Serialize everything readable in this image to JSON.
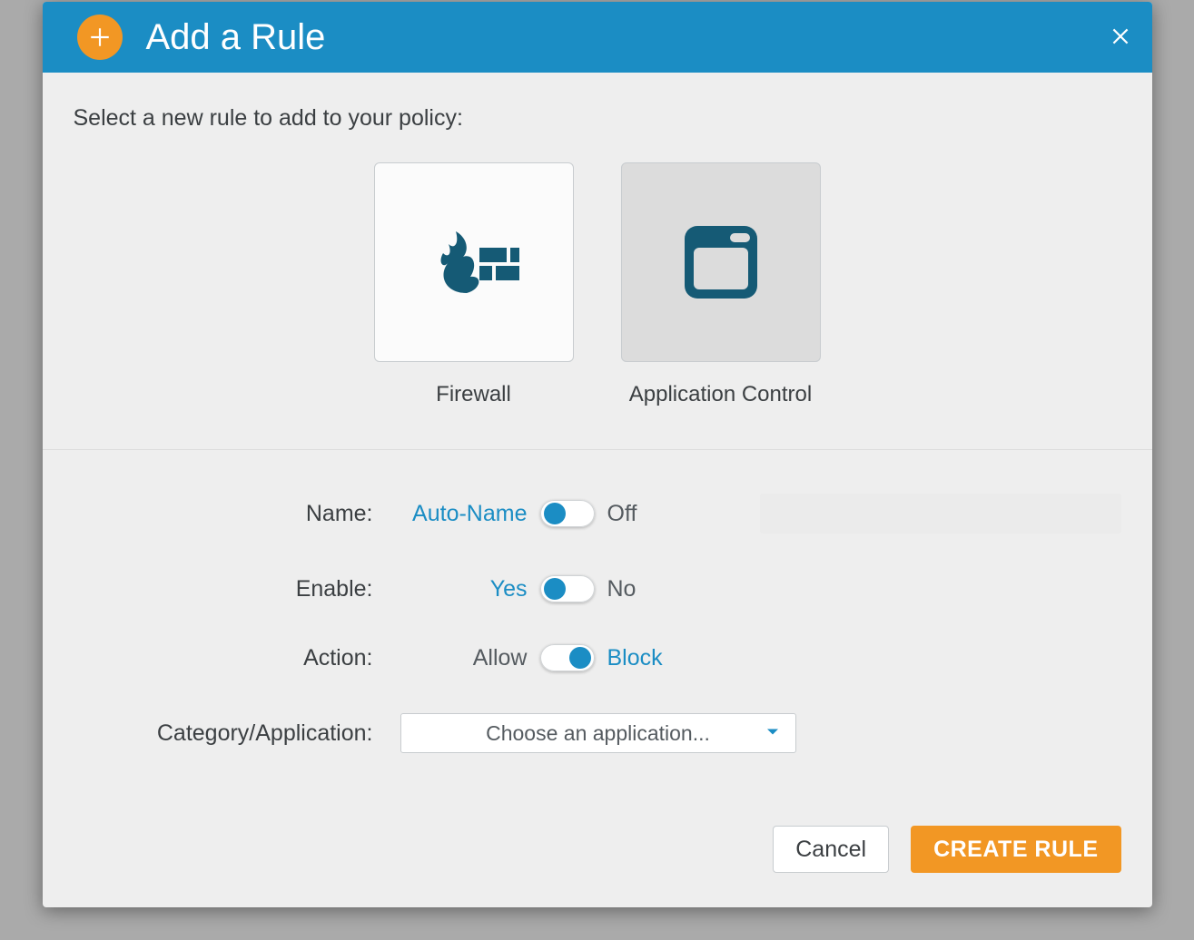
{
  "header": {
    "title": "Add a Rule",
    "close_icon": "close"
  },
  "prompt": "Select a new rule to add to your policy:",
  "rule_types": [
    {
      "id": "firewall",
      "label": "Firewall",
      "selected": false
    },
    {
      "id": "appcontrol",
      "label": "Application Control",
      "selected": true
    }
  ],
  "form": {
    "name": {
      "label": "Name:",
      "opt_left": "Auto-Name",
      "opt_right": "Off",
      "toggle_pos": "left",
      "input_value": ""
    },
    "enable": {
      "label": "Enable:",
      "opt_left": "Yes",
      "opt_right": "No",
      "toggle_pos": "left"
    },
    "action": {
      "label": "Action:",
      "opt_left": "Allow",
      "opt_right": "Block",
      "toggle_pos": "right"
    },
    "category": {
      "label": "Category/Application:",
      "placeholder": "Choose an application..."
    }
  },
  "footer": {
    "cancel": "Cancel",
    "create": "CREATE RULE"
  }
}
